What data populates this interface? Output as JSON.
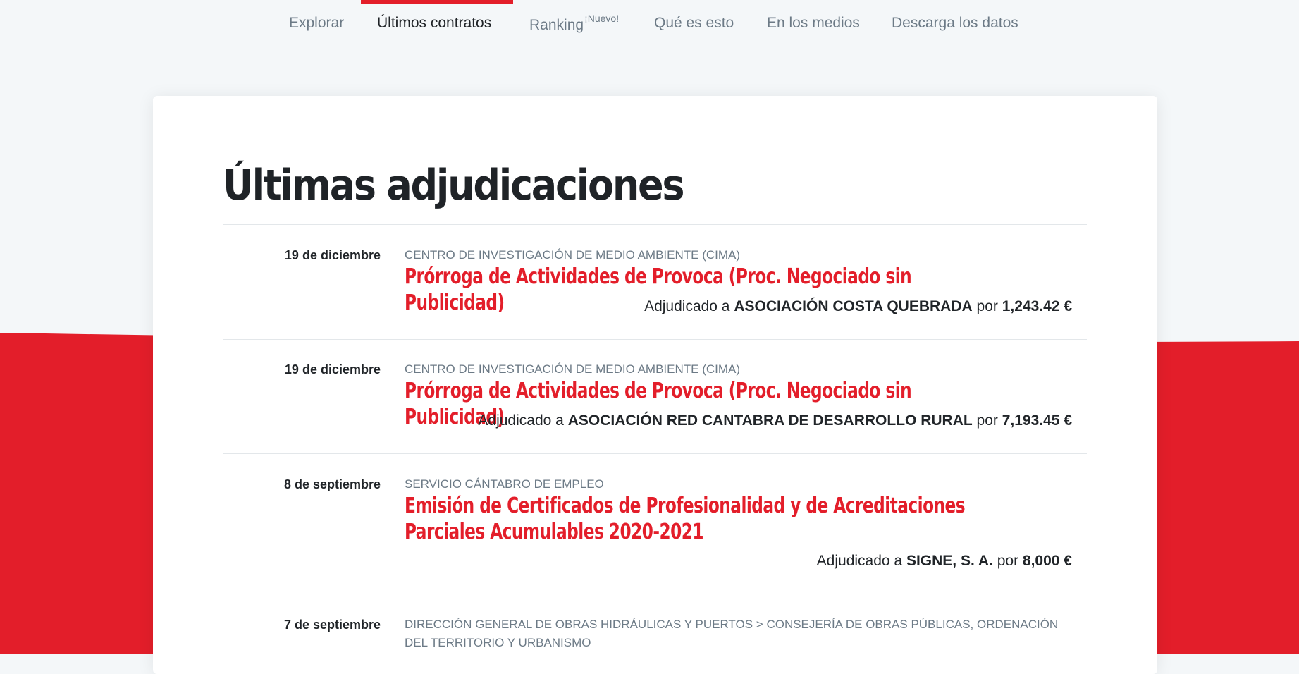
{
  "colors": {
    "accent": "#e31e2a",
    "background": "#f4f7f9",
    "card": "#ffffff"
  },
  "nav": {
    "items": [
      {
        "label": "Explorar",
        "active": false
      },
      {
        "label": "Últimos contratos",
        "active": true
      },
      {
        "label": "Ranking",
        "badge": "¡Nuevo!",
        "active": false
      },
      {
        "label": "Qué es esto",
        "active": false
      },
      {
        "label": "En los medios",
        "active": false
      },
      {
        "label": "Descarga los datos",
        "active": false
      }
    ]
  },
  "page": {
    "title": "Últimas adjudicaciones"
  },
  "award_prefix": "Adjudicado a",
  "award_for": "por",
  "contracts": [
    {
      "date": "19 de diciembre",
      "organization": "CENTRO DE INVESTIGACIÓN DE MEDIO AMBIENTE (CIMA)",
      "title": "Prórroga de Actividades de Provoca (Proc. Negociado sin Publicidad)",
      "awardee": "ASOCIACIÓN COSTA QUEBRADA",
      "amount": "1,243.42 €"
    },
    {
      "date": "19 de diciembre",
      "organization": "CENTRO DE INVESTIGACIÓN DE MEDIO AMBIENTE (CIMA)",
      "title": "Prórroga de Actividades de Provoca (Proc. Negociado sin Publicidad)",
      "awardee": "ASOCIACIÓN RED CANTABRA DE DESARROLLO RURAL",
      "amount": "7,193.45 €"
    },
    {
      "date": "8 de septiembre",
      "organization": "SERVICIO CÁNTABRO DE EMPLEO",
      "title": "Emisión de Certificados de Profesionalidad y de Acreditaciones Parciales Acumulables 2020-2021",
      "awardee": "SIGNE, S. A.",
      "amount": "8,000 €"
    },
    {
      "date": "7 de septiembre",
      "organization": "DIRECCIÓN GENERAL DE OBRAS HIDRÁULICAS Y PUERTOS > CONSEJERÍA DE OBRAS PÚBLICAS, ORDENACIÓN DEL TERRITORIO Y URBANISMO",
      "title": "",
      "awardee": "",
      "amount": ""
    }
  ]
}
